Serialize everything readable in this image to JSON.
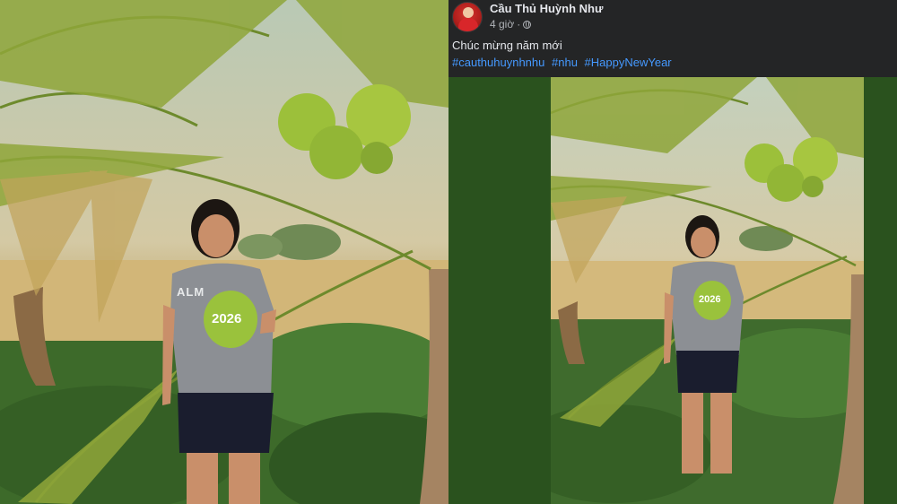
{
  "post": {
    "author": "Cầu Thủ Huỳnh Như",
    "time": "4 giờ",
    "separator": "·",
    "privacy_icon": "globe-icon",
    "caption": "Chúc mừng năm mới",
    "hashtags": [
      "#cauthuhuynhnhu",
      "#nhu",
      "#HappyNewYear"
    ]
  },
  "photos": {
    "left_coconut_label": "2026",
    "left_shirt_text": "ALM",
    "right_coconut_label": "2026"
  },
  "colors": {
    "header_bg": "#242526",
    "hashtag": "#4599ff",
    "panel_green": "#2a521e"
  }
}
